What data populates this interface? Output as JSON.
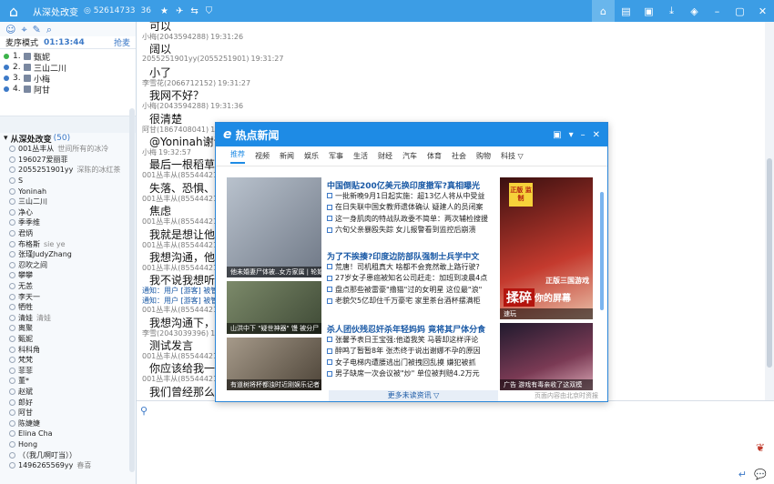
{
  "app": {
    "title": "从深处改变",
    "id_text": "◎ 52614733",
    "count": "36",
    "icons": [
      "star-icon",
      "plane-icon",
      "share-icon",
      "shield-icon"
    ],
    "window_controls": [
      "home-icon",
      "list-icon",
      "picture-icon",
      "download-icon",
      "skin-icon",
      "minimize-icon",
      "restore-icon",
      "close-icon"
    ]
  },
  "left": {
    "mode_label": "麦序模式",
    "timer": "01:13:44",
    "sticky": "抢麦",
    "queue": [
      {
        "num": "1.",
        "name": "甄妮"
      },
      {
        "num": "2.",
        "name": "三山二川"
      },
      {
        "num": "3.",
        "name": "小梅"
      },
      {
        "num": "4.",
        "name": "阿甘"
      }
    ],
    "group_name": "从深处改变",
    "group_count": "(50)",
    "members": [
      {
        "name": "001丛丰从",
        "note": "世间所有的冰冷"
      },
      {
        "name": "196027爱丽菲",
        "note": ""
      },
      {
        "name": "2055251901yy",
        "note": "深陈的冰红茶"
      },
      {
        "name": "S",
        "note": ""
      },
      {
        "name": "Yoninah",
        "note": ""
      },
      {
        "name": "三山二川",
        "note": ""
      },
      {
        "name": "净心",
        "note": ""
      },
      {
        "name": "季季维",
        "note": ""
      },
      {
        "name": "君炳",
        "note": ""
      },
      {
        "name": "布格斯",
        "note": "sie ye"
      },
      {
        "name": "张瑾JudyZhang",
        "note": ""
      },
      {
        "name": "忍吹之间",
        "note": ""
      },
      {
        "name": "攀攀",
        "note": ""
      },
      {
        "name": "无恙",
        "note": ""
      },
      {
        "name": "李天一",
        "note": ""
      },
      {
        "name": "牺牲",
        "note": ""
      },
      {
        "name": "清娃",
        "note": "清娃"
      },
      {
        "name": "离聚",
        "note": ""
      },
      {
        "name": "甄妮",
        "note": ""
      },
      {
        "name": "科科角",
        "note": ""
      },
      {
        "name": "梵梵",
        "note": ""
      },
      {
        "name": "菲菲",
        "note": ""
      },
      {
        "name": "董*",
        "note": ""
      },
      {
        "name": "赵斌",
        "note": ""
      },
      {
        "name": "郎好",
        "note": ""
      },
      {
        "name": "阿甘",
        "note": ""
      },
      {
        "name": "陈婕婕",
        "note": ""
      },
      {
        "name": "Elina Cha",
        "note": ""
      },
      {
        "name": "Hong",
        "note": ""
      },
      {
        "name": "（（我几啊叮当））",
        "note": ""
      },
      {
        "name": "1496265569yy",
        "note": "春喜"
      }
    ]
  },
  "chat": {
    "messages": [
      {
        "meta": "",
        "time": "",
        "text": "可以"
      },
      {
        "meta": "小梅(2043594288)",
        "time": "19:31:26",
        "text": ""
      },
      {
        "meta": "",
        "time": "",
        "text": "阔以"
      },
      {
        "meta": "2055251901yy(2055251901)",
        "time": "19:31:27",
        "text": ""
      },
      {
        "meta": "",
        "time": "",
        "text": "小了"
      },
      {
        "meta": "李雪花(2066712152)",
        "time": "19:31:27",
        "text": ""
      },
      {
        "meta": "",
        "time": "",
        "text": "我网不好？"
      },
      {
        "meta": "小梅(2043594288)",
        "time": "19:31:36",
        "text": ""
      },
      {
        "meta": "",
        "time": "",
        "text": "很清楚"
      },
      {
        "meta": "阿甘(1867408041)",
        "time": "19:32:0",
        "text": ""
      },
      {
        "meta": "",
        "time": "",
        "text": "@Yoninah谢谢"
      },
      {
        "meta": "小梅",
        "time": "19:32:57",
        "text": ""
      },
      {
        "meta": "",
        "time": "",
        "text": "最后一根稻草"
      },
      {
        "meta": "001丛丰从(85544421)",
        "time": "",
        "text": ""
      },
      {
        "meta": "",
        "time": "",
        "text": "失落、恐惧、交流"
      },
      {
        "meta": "001丛丰从(85544421)",
        "time": "",
        "text": ""
      },
      {
        "meta": "",
        "time": "",
        "text": "焦虑"
      },
      {
        "meta": "001丛丰从(85544421)",
        "time": "",
        "text": ""
      },
      {
        "meta": "",
        "time": "",
        "text": "我就是想让他有话"
      },
      {
        "meta": "001丛丰从(85544421)",
        "time": "",
        "text": ""
      },
      {
        "meta": "",
        "time": "",
        "text": "我想沟通，他就是"
      },
      {
        "meta": "001丛丰从(85544421)",
        "time": "",
        "text": ""
      },
      {
        "meta": "",
        "time": "",
        "text": "我不说我想听我说"
      },
      {
        "meta": "通知：用户 [游客] 被管",
        "time": "",
        "text": ""
      },
      {
        "meta": "通知：用户 [游客] 被管",
        "time": "",
        "text": ""
      },
      {
        "meta": "001丛丰从(85544421)",
        "time": "",
        "text": ""
      },
      {
        "meta": "",
        "time": "",
        "text": "我想沟通下，为什"
      },
      {
        "meta": "李雪(2043039396)",
        "time": "19:37",
        "text": ""
      },
      {
        "meta": "",
        "time": "",
        "text": "测试发言"
      },
      {
        "meta": "001丛丰从(85544421)",
        "time": "",
        "text": ""
      },
      {
        "meta": "",
        "time": "",
        "text": "你应该给我一个机"
      },
      {
        "meta": "001丛丰从(85544421)",
        "time": "",
        "text": ""
      },
      {
        "meta": "",
        "time": "",
        "text": "我们曾经那么美好"
      }
    ]
  },
  "popup": {
    "logo": "e",
    "title": "热点新闻",
    "controls": [
      "window-icon",
      "dropdown-icon",
      "minimize-icon",
      "close-icon"
    ],
    "tabs": [
      "推荐",
      "视频",
      "新闻",
      "娱乐",
      "军事",
      "生活",
      "财经",
      "汽车",
      "体育",
      "社会",
      "购物",
      "科技 ▽"
    ],
    "images": [
      {
        "caption": "他未婚妻尸体被..女方家属 | 轮婚"
      },
      {
        "caption": "山洪中下 \"疑世神器\" 馒 被分尸"
      },
      {
        "caption": "有道树将杯都浊时近刚娱乐记者"
      }
    ],
    "groups": [
      {
        "headline": "中国倒贴200亿美元换印度撤军?真相曝光",
        "items": [
          "一批新晚9月1日起实施：超13亿人将从中受益",
          "在日失联中国女教师遗体确认 疑建人的员闭案",
          "这一身肌肉的特战队政委不简单：两次辅检搜援",
          "六旬父亲暴殴失踪 女儿报警看到监控后崩溃"
        ]
      },
      {
        "headline": "为了不挨揍?印度边防部队强制士兵学中文",
        "items": [
          "荒唐！司机租真大 啥都不会竟然敢上路行驶?",
          "27岁女子患癌被知名公司赶走：加班到凌晨4点",
          "盘点那些被雷豪\"撸猫\"过的女明星 这位最\"浪\"",
          "老貌欠5亿却住千万豪宅 家里茶台酒杯摆满柜"
        ]
      },
      {
        "headline": "杀人团伙残忍奸杀年轻妈妈 竟将其尸体分食",
        "items": [
          "张馨予表日王宝强:他道我笑 马蓉却这样评论",
          "醉鸣了暂暂8年 张杰终于说出谢娜不孕的原因",
          "女子电梯内遭腰逃出门被拽回乱摸 嫌犯被抓",
          "男子缺席一次会议被\"炒\" 单位被判赔4.2万元"
        ]
      }
    ],
    "ads": [
      {
        "tag": "正版 监制",
        "game": "正版三国游戏",
        "big": "揉碎",
        "slogan": "你的屏幕",
        "cap": "速玩"
      },
      {
        "tag": "",
        "game": "",
        "big": "",
        "slogan": "",
        "cap": "广告 游戏有毒亲收了这双模"
      }
    ],
    "more": "更多未读资讯 ▽",
    "footer": "页面内容由北京时资报"
  },
  "colors": {
    "titlebar": "#3c9de5",
    "accent": "#1e8be5"
  }
}
